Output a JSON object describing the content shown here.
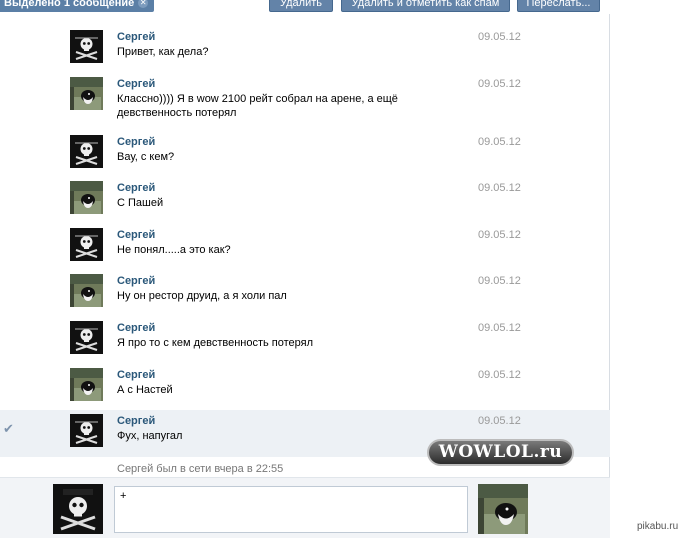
{
  "toolbar": {
    "selected_label": "Выделено 1 сообщение",
    "delete_label": "Удалить",
    "spam_label": "Удалить и отметить как спам",
    "forward_label": "Переслать..."
  },
  "messages": [
    {
      "author": "Сергей",
      "date": "09.05.12",
      "text": "Привет, как дела?",
      "avatar": "pirate-avatar"
    },
    {
      "author": "Сергей",
      "date": "09.05.12",
      "text": "Классно)))) Я в wow 2100 рейт собрал на арене, а ещё девственность потерял",
      "avatar": "cat-avatar"
    },
    {
      "author": "Сергей",
      "date": "09.05.12",
      "text": "Вау, с кем?",
      "avatar": "pirate-avatar"
    },
    {
      "author": "Сергей",
      "date": "09.05.12",
      "text": "С Пашей",
      "avatar": "cat-avatar"
    },
    {
      "author": "Сергей",
      "date": "09.05.12",
      "text": "Не понял.....а это как?",
      "avatar": "pirate-avatar"
    },
    {
      "author": "Сергей",
      "date": "09.05.12",
      "text": "Ну он рестор друид, а я холи пал",
      "avatar": "cat-avatar"
    },
    {
      "author": "Сергей",
      "date": "09.05.12",
      "text": "Я про то с кем девственность потерял",
      "avatar": "pirate-avatar"
    },
    {
      "author": "Сергей",
      "date": "09.05.12",
      "text": "А с Настей",
      "avatar": "cat-avatar"
    },
    {
      "author": "Сергей",
      "date": "09.05.12",
      "text": "Фух, напугал",
      "avatar": "pirate-avatar",
      "selected": true
    }
  ],
  "status": "Сергей был в сети вчера в 22:55",
  "composer": {
    "value": "+"
  },
  "watermark": "WOWLOL.ru",
  "site_tag": "pikabu.ru",
  "colors": {
    "accent": "#5b7fa6",
    "author": "#2b587a",
    "selected_bg": "#edf1f5"
  }
}
